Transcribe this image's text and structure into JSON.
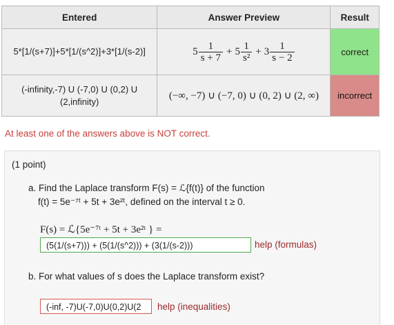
{
  "table": {
    "headers": {
      "entered": "Entered",
      "preview": "Answer Preview",
      "result": "Result"
    },
    "rows": [
      {
        "entered": "5*[1/(s+7)]+5*[1/(s^2)]+3*[1/(s-2)]",
        "preview": {
          "coef1": "5",
          "num1": "1",
          "den1": "s + 7",
          "plus1": "+",
          "coef2": "5",
          "num2": "1",
          "den2": "s²",
          "plus2": "+",
          "coef3": "3",
          "num3": "1",
          "den3": "s − 2"
        },
        "result": "correct",
        "result_color": "#8fe38a"
      },
      {
        "entered": "(-infinity,-7) U (-7,0) U (0,2) U (2,infinity)",
        "preview": "(−∞, −7) ∪ (−7, 0) ∪ (0, 2) ∪ (2, ∞)",
        "result": "incorrect",
        "result_color": "#d88b88"
      }
    ]
  },
  "warning": "At least one of the answers above is NOT correct.",
  "problem": {
    "points": "(1 point)",
    "part_a": {
      "line1": "a. Find the Laplace transform F(s) = ℒ{f(t)} of the function",
      "line2": "f(t) = 5e⁻⁷ᵗ + 5t + 3e²ᵗ, defined on the interval t ≥ 0.",
      "equation": "F(s) = ℒ{5e⁻⁷ᵗ + 5t + 3e²ᵗ } =",
      "answer_value": "(5(1/(s+7))) + (5(1/(s^2))) + (3(1/(s-2)))",
      "help": "help (formulas)"
    },
    "part_b": {
      "question": "b. For what values of s does the Laplace transform exist?",
      "answer_value": "(-inf, -7)U(-7,0)U(0,2)U(2",
      "help": "help (inequalities)"
    }
  },
  "colors": {
    "correct": "#8fe38a",
    "incorrect": "#d88b88",
    "warning": "#c6413c",
    "help": "#9b2a2a"
  }
}
